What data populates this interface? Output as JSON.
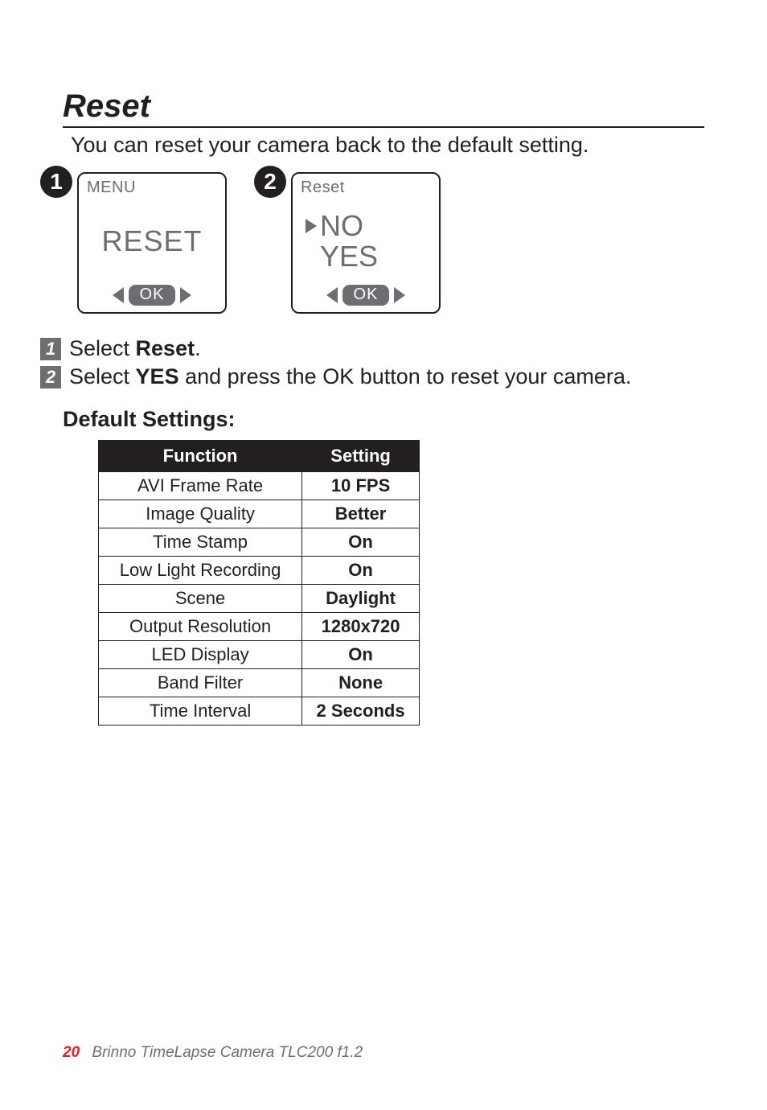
{
  "heading": "Reset",
  "intro": "You can reset your camera back to the default setting.",
  "screens": {
    "step1_badge": "1",
    "step2_badge": "2",
    "screen1": {
      "title": "MENU",
      "main": "RESET",
      "ok": "OK"
    },
    "screen2": {
      "title": "Reset",
      "opt_no": "NO",
      "opt_yes": "YES",
      "ok": "OK"
    }
  },
  "steps": {
    "n1": "1",
    "n2": "2",
    "line1_pre": "Select ",
    "line1_bold": "Reset",
    "line1_post": ".",
    "line2_pre": "Select ",
    "line2_bold": "YES",
    "line2_post": " and press the OK button to reset your camera."
  },
  "defaults": {
    "heading": "Default Settings:",
    "header_function": "Function",
    "header_setting": "Setting",
    "rows": [
      {
        "fn": "AVI Frame Rate",
        "val": "10 FPS"
      },
      {
        "fn": "Image Quality",
        "val": "Better"
      },
      {
        "fn": "Time Stamp",
        "val": "On"
      },
      {
        "fn": "Low Light Recording",
        "val": "On"
      },
      {
        "fn": "Scene",
        "val": "Daylight"
      },
      {
        "fn": "Output Resolution",
        "val": "1280x720"
      },
      {
        "fn": "LED Display",
        "val": "On"
      },
      {
        "fn": "Band Filter",
        "val": "None"
      },
      {
        "fn": "Time Interval",
        "val": "2 Seconds"
      }
    ]
  },
  "footer": {
    "page": "20",
    "title": "Brinno TimeLapse Camera  TLC200 f1.2"
  }
}
